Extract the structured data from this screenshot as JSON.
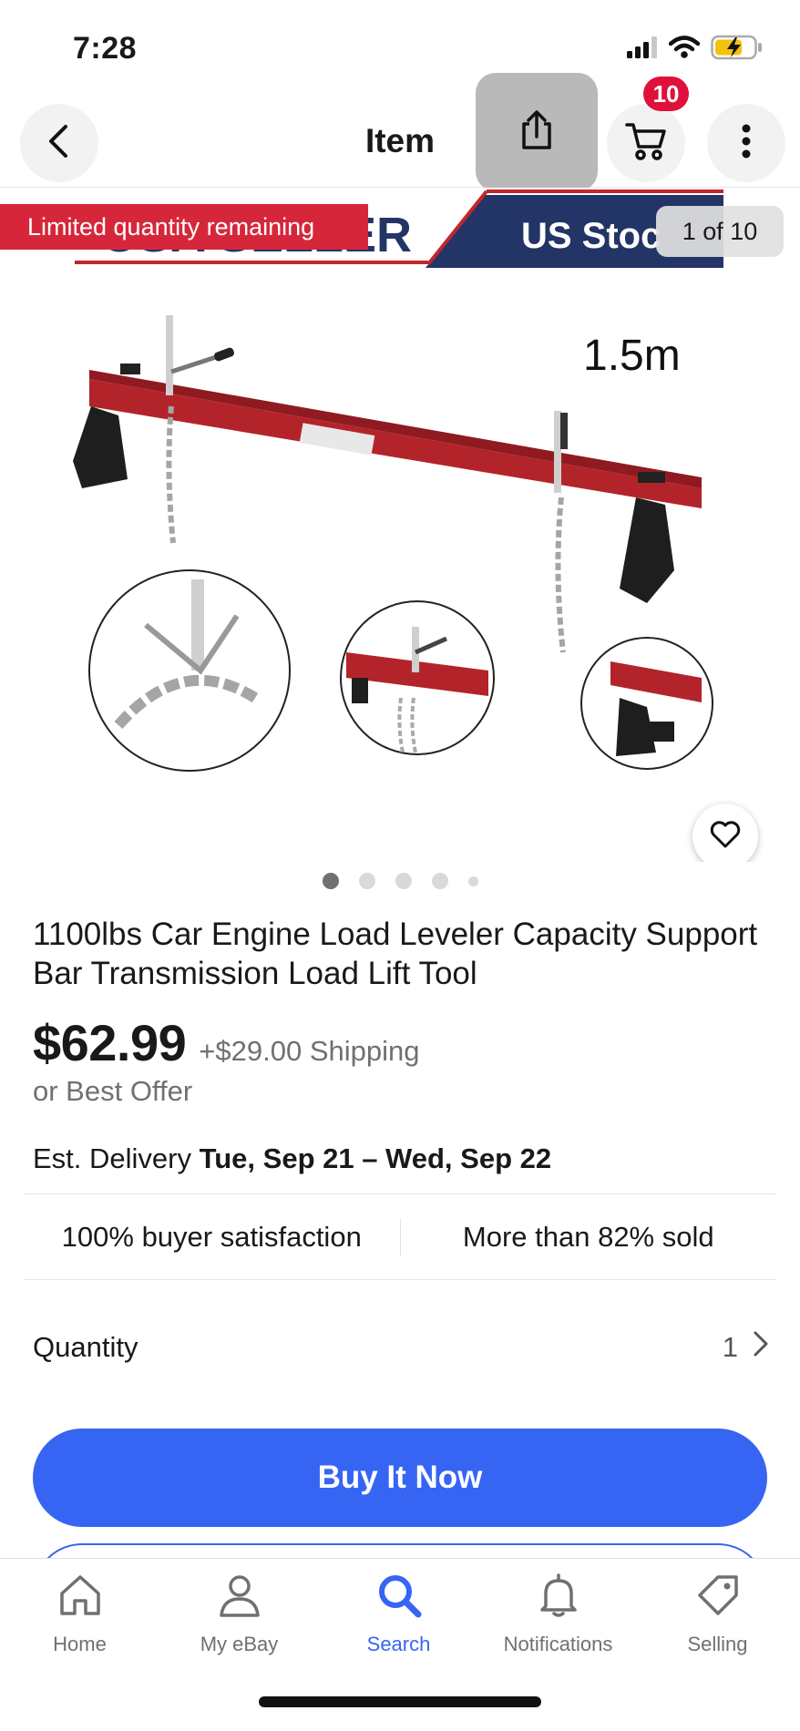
{
  "status_bar": {
    "time": "7:28",
    "icons": [
      "signal-icon",
      "wifi-icon",
      "battery-charging-icon"
    ]
  },
  "nav": {
    "title": "Item",
    "cart_count": "10",
    "icons": [
      "back-icon",
      "share-icon",
      "cart-icon",
      "more-icon"
    ]
  },
  "image": {
    "limited_label": "Limited quantity remaining",
    "counter": "1 of 10",
    "banner_text": "US Stoc",
    "dimension_label": "1.5m",
    "dots_total": 5,
    "active_dot": 1
  },
  "item": {
    "title": "1100lbs Car Engine Load Leveler Capacity Support Bar Transmission Load Lift Tool",
    "price": "$62.99",
    "shipping": "+$29.00 Shipping",
    "best_offer": "or Best Offer",
    "delivery_prefix": "Est. Delivery",
    "delivery_dates": "Tue, Sep 21 – Wed, Sep 22",
    "stat_satisfaction": "100% buyer satisfaction",
    "stat_sold": "More than 82% sold",
    "quantity_label": "Quantity",
    "quantity_value": "1",
    "buy_now": "Buy It Now"
  },
  "tabs": [
    {
      "label": "Home",
      "icon": "home-icon"
    },
    {
      "label": "My eBay",
      "icon": "person-icon"
    },
    {
      "label": "Search",
      "icon": "search-icon",
      "active": true
    },
    {
      "label": "Notifications",
      "icon": "bell-icon"
    },
    {
      "label": "Selling",
      "icon": "tag-icon"
    }
  ],
  "colors": {
    "accent": "#3665f3",
    "badge_red": "#d6273a",
    "cart_badge": "#e0103a",
    "product_red": "#b3242a"
  }
}
